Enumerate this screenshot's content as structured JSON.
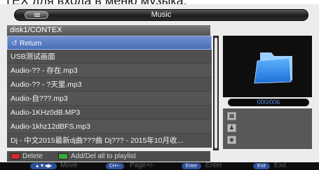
{
  "caption": "TEX для входа в меню музыка.",
  "app": {
    "title": "Music"
  },
  "path": "disk1/CONTEX",
  "files": [
    {
      "name": "Return",
      "selected": true
    },
    {
      "name": "USB测试画面"
    },
    {
      "name": "Audio-?? - 存在.mp3"
    },
    {
      "name": "Audio-?? - ?天里.mp3"
    },
    {
      "name": "Audio-自???.mp3"
    },
    {
      "name": "Audio-1KHz0dB.MP3"
    },
    {
      "name": "Audio-1khz12dBFS.mp3"
    },
    {
      "name": "Dj - 中文2015最新dj曲???曲 Dj??? - 2015年10月收..."
    }
  ],
  "counter": "000/006",
  "hints": {
    "red": "Delete",
    "green": "Add/Del all to playlist"
  },
  "keys": [
    {
      "key": "▲▼◀▶",
      "label": "Move"
    },
    {
      "key": "CH+-",
      "label": "Page+/-"
    },
    {
      "key": "Enter",
      "label": "Enter"
    },
    {
      "key": "Exit",
      "label": "Exit"
    }
  ],
  "colors": {
    "selection": "#5a7fc6",
    "counter_text": "#5c8fe6",
    "red_button": "#d22a2a",
    "green_button": "#3aa83a"
  },
  "icons": [
    "menu-icon",
    "return-icon",
    "folder-icon",
    "grid-icon",
    "person-icon",
    "disc-icon"
  ]
}
